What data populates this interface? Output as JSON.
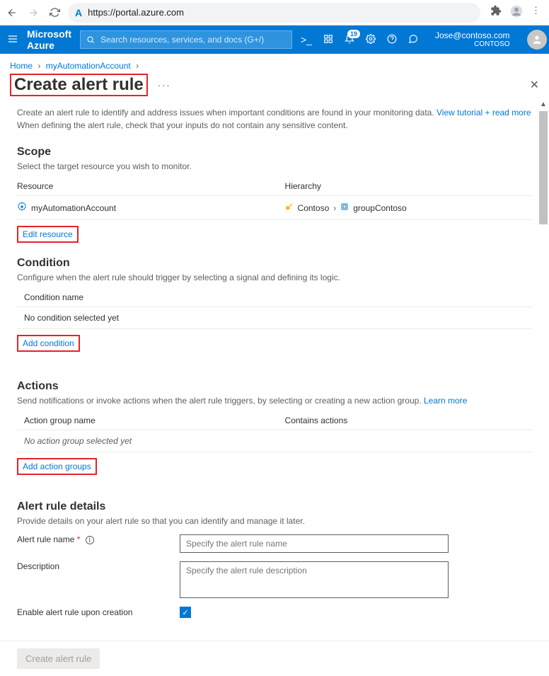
{
  "browser": {
    "url": "https://portal.azure.com"
  },
  "header": {
    "brand": "Microsoft Azure",
    "search_placeholder": "Search resources, services, and docs (G+/)",
    "notification_count": "19",
    "user_email": "Jose@contoso.com",
    "user_tenant": "CONTOSO"
  },
  "breadcrumb": {
    "items": [
      "Home",
      "myAutomationAccount"
    ]
  },
  "page": {
    "title": "Create alert rule",
    "desc_line1": "Create an alert rule to identify and address issues when important conditions are found in your monitoring data.",
    "desc_link": "View tutorial + read more",
    "desc_line2": "When defining the alert rule, check that your inputs do not contain any sensitive content."
  },
  "scope": {
    "heading": "Scope",
    "sub": "Select the target resource you wish to monitor.",
    "col_a": "Resource",
    "col_b": "Hierarchy",
    "resource_name": "myAutomationAccount",
    "hierarchy_a": "Contoso",
    "hierarchy_b": "groupContoso",
    "edit_link": "Edit resource"
  },
  "condition": {
    "heading": "Condition",
    "sub": "Configure when the alert rule should trigger by selecting a signal and defining its logic.",
    "col_a": "Condition name",
    "empty": "No condition selected yet",
    "add_link": "Add condition"
  },
  "actions": {
    "heading": "Actions",
    "sub_text": "Send notifications or invoke actions when the alert rule triggers, by selecting or creating a new action group.",
    "sub_link": "Learn more",
    "col_a": "Action group name",
    "col_b": "Contains actions",
    "empty": "No action group selected yet",
    "add_link": "Add action groups"
  },
  "details": {
    "heading": "Alert rule details",
    "sub": "Provide details on your alert rule so that you can identify and manage it later.",
    "name_label": "Alert rule name",
    "name_placeholder": "Specify the alert rule name",
    "desc_label": "Description",
    "desc_placeholder": "Specify the alert rule description",
    "enable_label": "Enable alert rule upon creation"
  },
  "footer": {
    "create_label": "Create alert rule"
  }
}
